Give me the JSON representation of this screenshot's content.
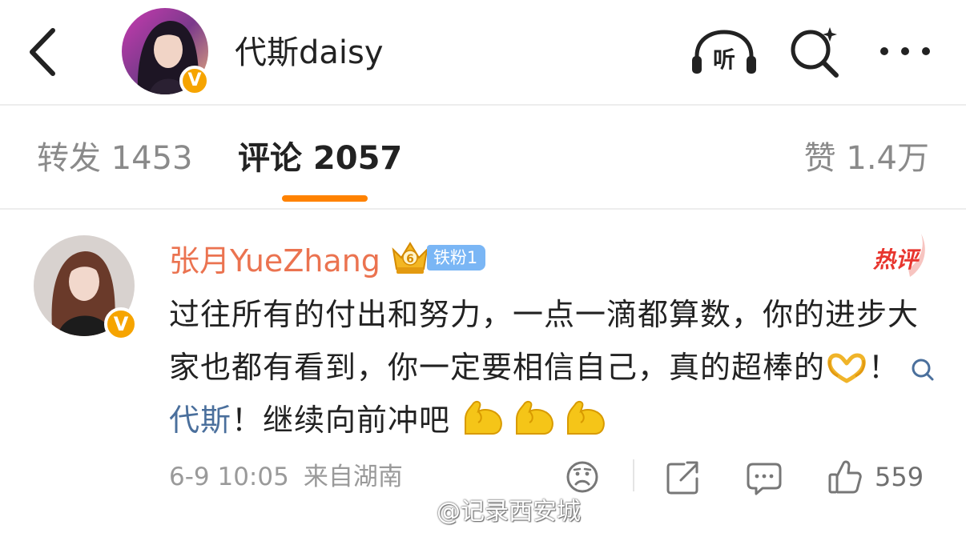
{
  "header": {
    "user_name": "代斯daisy",
    "verified_mark": "V",
    "listen_label": "听",
    "icons": [
      "back-arrow-icon",
      "headphones-icon",
      "search-icon",
      "more-dots-icon"
    ]
  },
  "tabs": [
    {
      "label": "转发 1453",
      "active": false
    },
    {
      "label": "评论 2057",
      "active": true
    },
    {
      "label": "赞 1.4万",
      "active": false
    }
  ],
  "comment": {
    "author": "张月YueZhang",
    "verified_mark": "V",
    "fan_badge": "铁粉1",
    "fan_level_number": "6",
    "hot_tag": "热评",
    "text_part1": "过往所有的付出和努力，一点一滴都算数，你的进步大家也都有看到，你一定要相信自己，真的超棒的",
    "text_part2": "！",
    "mention": "代斯",
    "text_part3": "！继续向前冲吧",
    "timestamp": "6-9 10:05",
    "location": "来自湖南",
    "like_count": "559"
  },
  "watermark": "@记录西安城",
  "colors": {
    "accent_orange": "#ff8200",
    "author_name": "#eb7350",
    "link_blue": "#4a6f9c",
    "fan_badge": "#7ab6f5",
    "hot_red": "#e8352e",
    "verified_gold": "#f6a400"
  }
}
